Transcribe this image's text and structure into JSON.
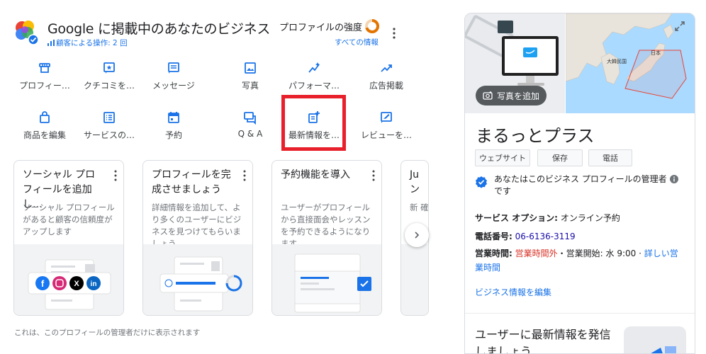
{
  "header": {
    "title": "Google に掲載中のあなたのビジネス",
    "interactions": "顧客による操作: 2 回",
    "strength_label": "プロファイルの強度",
    "all_info": "すべての情報",
    "strength_progress": 0.7
  },
  "actions": [
    {
      "icon": "storefront-icon",
      "label": "プロフィー…"
    },
    {
      "icon": "review-star-icon",
      "label": "クチコミを…"
    },
    {
      "icon": "message-icon",
      "label": "メッセージ"
    },
    {
      "icon": "photo-icon",
      "label": "写真"
    },
    {
      "icon": "performance-icon",
      "label": "パフォーマ…"
    },
    {
      "icon": "trending-icon",
      "label": "広告掲載"
    },
    {
      "icon": "shopping-bag-icon",
      "label": "商品を編集"
    },
    {
      "icon": "list-icon",
      "label": "サービスの…"
    },
    {
      "icon": "calendar-icon",
      "label": "予約"
    },
    {
      "icon": "qa-icon",
      "label": "Q & A"
    },
    {
      "icon": "add-post-icon",
      "label": "最新情報を…"
    },
    {
      "icon": "review-request-icon",
      "label": "レビューを…"
    }
  ],
  "cards": [
    {
      "title": "ソーシャル プロフィールを追加し…",
      "desc": "ソーシャル プロフィールがあると顧客の信頼度がアップします"
    },
    {
      "title": "プロフィールを完成させましょう",
      "desc": "詳細情報を追加して、より多くのユーザーにビジネスを見つけてもらいましょう"
    },
    {
      "title": "予約機能を導入",
      "desc": "ユーザーがプロフィールから直接面会やレッスンを予約できるようになります"
    },
    {
      "title": "Ju ン",
      "desc": "新 確"
    }
  ],
  "admin_note": "これは、このプロフィールの管理者だけに表示されます",
  "panel": {
    "add_photo": "写真を追加",
    "map_labels": {
      "korea": "大韓民国",
      "japan": "日本"
    },
    "business_name": "まるっとプラス",
    "buttons": [
      "ウェブサイト",
      "保存",
      "電話"
    ],
    "admin_text_1": "あなたはこのビジネス プロフィールの管理者",
    "admin_text_2": "です",
    "service_label": "サービス オプション:",
    "service_value": "オンライン予約",
    "phone_label": "電話番号:",
    "phone_value": "06-6136-3119",
    "hours_label": "営業時間:",
    "hours_status": "営業時間外",
    "hours_next": "・営業開始: 水 9:00 ·",
    "hours_link_1": "詳しい営",
    "hours_link_2": "業時間",
    "edit_link": "ビジネス情報を編集",
    "promo_1": "ユーザーに最新情報を発信",
    "promo_2": "しましょう"
  },
  "colors": {
    "accent": "#1a73e8",
    "highlight": "#e8202b",
    "closed": "#d93025"
  }
}
